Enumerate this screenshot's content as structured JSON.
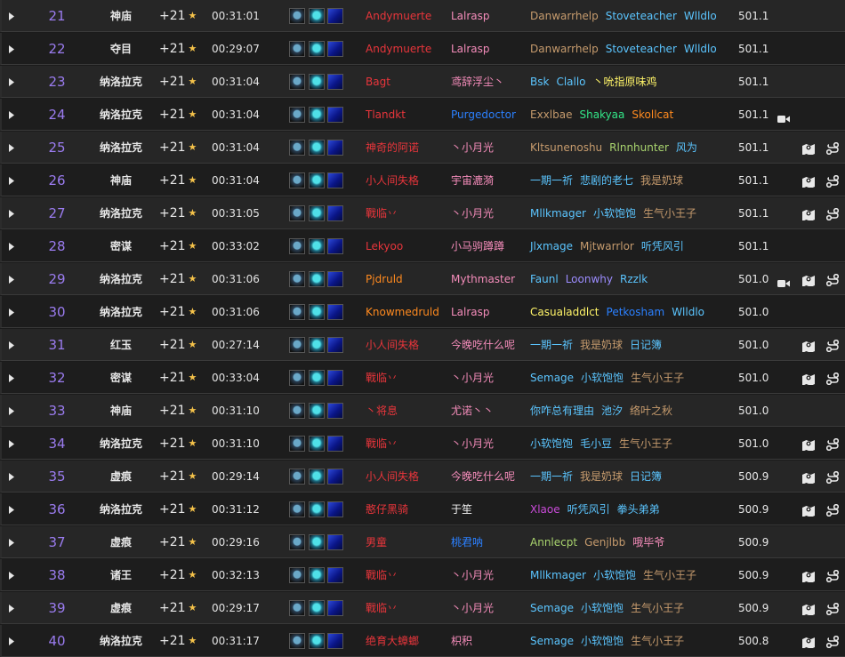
{
  "colors": {
    "rank": "#9b7cf0",
    "star": "#f6c34a",
    "class": {
      "dk": "#e8353b",
      "dh": "#c94bd8",
      "druid": "#ff8a1f",
      "hunter": "#a9d46e",
      "mage": "#5bc5ff",
      "monk": "#33e688",
      "paladin": "#f48cba",
      "priest": "#f4f4f4",
      "rogue": "#fff468",
      "shaman": "#2b80ff",
      "warlock": "#9c8cff",
      "warrior": "#c69b6d"
    }
  },
  "rows": [
    {
      "rank": "21",
      "dungeon": "神庙",
      "level": "+21",
      "time": "00:31:01",
      "tank": {
        "name": "Andymuerte",
        "c": "dk"
      },
      "healer": {
        "name": "Lalrasp",
        "c": "paladin"
      },
      "dps": [
        {
          "name": "Danwarrhelp",
          "c": "warrior"
        },
        {
          "name": "Stoveteacher",
          "c": "mage"
        },
        {
          "name": "Wlldlo",
          "c": "mage"
        }
      ],
      "score": "501.1",
      "video": false,
      "icons": false
    },
    {
      "rank": "22",
      "dungeon": "夺目",
      "level": "+21",
      "time": "00:29:07",
      "tank": {
        "name": "Andymuerte",
        "c": "dk"
      },
      "healer": {
        "name": "Lalrasp",
        "c": "paladin"
      },
      "dps": [
        {
          "name": "Danwarrhelp",
          "c": "warrior"
        },
        {
          "name": "Stoveteacher",
          "c": "mage"
        },
        {
          "name": "Wlldlo",
          "c": "mage"
        }
      ],
      "score": "501.1",
      "video": false,
      "icons": false
    },
    {
      "rank": "23",
      "dungeon": "纳洛拉克",
      "level": "+21",
      "time": "00:31:04",
      "tank": {
        "name": "Bagt",
        "c": "dk"
      },
      "healer": {
        "name": "鸢辞浮尘丶",
        "c": "paladin"
      },
      "dps": [
        {
          "name": "Bsk",
          "c": "mage"
        },
        {
          "name": "Clallo",
          "c": "mage"
        },
        {
          "name": "丶吮指原味鸡",
          "c": "rogue"
        }
      ],
      "score": "501.1",
      "video": false,
      "icons": false
    },
    {
      "rank": "24",
      "dungeon": "纳洛拉克",
      "level": "+21",
      "time": "00:31:04",
      "tank": {
        "name": "Tlandkt",
        "c": "dk"
      },
      "healer": {
        "name": "Purgedoctor",
        "c": "shaman"
      },
      "dps": [
        {
          "name": "Exxlbae",
          "c": "warrior"
        },
        {
          "name": "Shakyaa",
          "c": "monk"
        },
        {
          "name": "Skollcat",
          "c": "druid"
        }
      ],
      "score": "501.1",
      "video": true,
      "icons": false
    },
    {
      "rank": "25",
      "dungeon": "纳洛拉克",
      "level": "+21",
      "time": "00:31:04",
      "tank": {
        "name": "神奇的阿诺",
        "c": "dk"
      },
      "healer": {
        "name": "丶小月光",
        "c": "paladin"
      },
      "dps": [
        {
          "name": "Kltsunenoshu",
          "c": "warrior"
        },
        {
          "name": "Rlnnhunter",
          "c": "hunter"
        },
        {
          "name": "风为",
          "c": "mage"
        }
      ],
      "score": "501.1",
      "video": false,
      "icons": true
    },
    {
      "rank": "26",
      "dungeon": "神庙",
      "level": "+21",
      "time": "00:31:04",
      "tank": {
        "name": "小人间失格",
        "c": "dk"
      },
      "healer": {
        "name": "宇宙漉漪",
        "c": "paladin"
      },
      "dps": [
        {
          "name": "一期一祈",
          "c": "mage"
        },
        {
          "name": "悲剧的老七",
          "c": "mage"
        },
        {
          "name": "我是奶球",
          "c": "warrior"
        }
      ],
      "score": "501.1",
      "video": false,
      "icons": true
    },
    {
      "rank": "27",
      "dungeon": "纳洛拉克",
      "level": "+21",
      "time": "00:31:05",
      "tank": {
        "name": "戰临丷",
        "c": "dk"
      },
      "healer": {
        "name": "丶小月光",
        "c": "paladin"
      },
      "dps": [
        {
          "name": "Mllkmager",
          "c": "mage"
        },
        {
          "name": "小软饱饱",
          "c": "mage"
        },
        {
          "name": "生气小王子",
          "c": "warrior"
        }
      ],
      "score": "501.1",
      "video": false,
      "icons": true
    },
    {
      "rank": "28",
      "dungeon": "密谋",
      "level": "+21",
      "time": "00:33:02",
      "tank": {
        "name": "Lekyoo",
        "c": "dk"
      },
      "healer": {
        "name": "小马驹蹲蹲",
        "c": "paladin"
      },
      "dps": [
        {
          "name": "Jlxmage",
          "c": "mage"
        },
        {
          "name": "Mjtwarrlor",
          "c": "warrior"
        },
        {
          "name": "听凭风引",
          "c": "mage"
        }
      ],
      "score": "501.1",
      "video": false,
      "icons": false
    },
    {
      "rank": "29",
      "dungeon": "纳洛拉克",
      "level": "+21",
      "time": "00:31:06",
      "tank": {
        "name": "Pjdruld",
        "c": "druid"
      },
      "healer": {
        "name": "Mythmaster",
        "c": "paladin"
      },
      "dps": [
        {
          "name": "Faunl",
          "c": "mage"
        },
        {
          "name": "Loonwhy",
          "c": "warlock"
        },
        {
          "name": "Rzzlk",
          "c": "mage"
        }
      ],
      "score": "501.0",
      "video": true,
      "icons": true
    },
    {
      "rank": "30",
      "dungeon": "纳洛拉克",
      "level": "+21",
      "time": "00:31:06",
      "tank": {
        "name": "Knowmedruld",
        "c": "druid"
      },
      "healer": {
        "name": "Lalrasp",
        "c": "paladin"
      },
      "dps": [
        {
          "name": "Casualaddlct",
          "c": "rogue"
        },
        {
          "name": "Petkosham",
          "c": "shaman"
        },
        {
          "name": "Wlldlo",
          "c": "mage"
        }
      ],
      "score": "501.0",
      "video": false,
      "icons": false
    },
    {
      "rank": "31",
      "dungeon": "红玉",
      "level": "+21",
      "time": "00:27:14",
      "tank": {
        "name": "小人间失格",
        "c": "dk"
      },
      "healer": {
        "name": "今晚吃什么呢",
        "c": "paladin"
      },
      "dps": [
        {
          "name": "一期一祈",
          "c": "mage"
        },
        {
          "name": "我是奶球",
          "c": "warrior"
        },
        {
          "name": "日记簿",
          "c": "mage"
        }
      ],
      "score": "501.0",
      "video": false,
      "icons": true
    },
    {
      "rank": "32",
      "dungeon": "密谋",
      "level": "+21",
      "time": "00:33:04",
      "tank": {
        "name": "戰临丷",
        "c": "dk"
      },
      "healer": {
        "name": "丶小月光",
        "c": "paladin"
      },
      "dps": [
        {
          "name": "Semage",
          "c": "mage"
        },
        {
          "name": "小软饱饱",
          "c": "mage"
        },
        {
          "name": "生气小王子",
          "c": "warrior"
        }
      ],
      "score": "501.0",
      "video": false,
      "icons": true
    },
    {
      "rank": "33",
      "dungeon": "神庙",
      "level": "+21",
      "time": "00:31:10",
      "tank": {
        "name": "丶将息",
        "c": "dk"
      },
      "healer": {
        "name": "尤诺丶丶",
        "c": "paladin"
      },
      "dps": [
        {
          "name": "你咋总有理由",
          "c": "mage"
        },
        {
          "name": "池汐",
          "c": "mage"
        },
        {
          "name": "络叶之秋",
          "c": "warrior"
        }
      ],
      "score": "501.0",
      "video": false,
      "icons": false
    },
    {
      "rank": "34",
      "dungeon": "纳洛拉克",
      "level": "+21",
      "time": "00:31:10",
      "tank": {
        "name": "戰临丷",
        "c": "dk"
      },
      "healer": {
        "name": "丶小月光",
        "c": "paladin"
      },
      "dps": [
        {
          "name": "小软饱饱",
          "c": "mage"
        },
        {
          "name": "毛小豆",
          "c": "mage"
        },
        {
          "name": "生气小王子",
          "c": "warrior"
        }
      ],
      "score": "501.0",
      "video": false,
      "icons": true
    },
    {
      "rank": "35",
      "dungeon": "虚痕",
      "level": "+21",
      "time": "00:29:14",
      "tank": {
        "name": "小人间失格",
        "c": "dk"
      },
      "healer": {
        "name": "今晚吃什么呢",
        "c": "paladin"
      },
      "dps": [
        {
          "name": "一期一祈",
          "c": "mage"
        },
        {
          "name": "我是奶球",
          "c": "warrior"
        },
        {
          "name": "日记簿",
          "c": "mage"
        }
      ],
      "score": "500.9",
      "video": false,
      "icons": true
    },
    {
      "rank": "36",
      "dungeon": "纳洛拉克",
      "level": "+21",
      "time": "00:31:12",
      "tank": {
        "name": "憨仔黑骑",
        "c": "dk"
      },
      "healer": {
        "name": "于笙",
        "c": "priest"
      },
      "dps": [
        {
          "name": "Xlaoe",
          "c": "dh"
        },
        {
          "name": "听凭风引",
          "c": "mage"
        },
        {
          "name": "拳头弟弟",
          "c": "mage"
        }
      ],
      "score": "500.9",
      "video": false,
      "icons": true
    },
    {
      "rank": "37",
      "dungeon": "虚痕",
      "level": "+21",
      "time": "00:29:16",
      "tank": {
        "name": "男童",
        "c": "dk"
      },
      "healer": {
        "name": "桃君呐",
        "c": "shaman"
      },
      "dps": [
        {
          "name": "Annlecpt",
          "c": "hunter"
        },
        {
          "name": "Genjlbb",
          "c": "warrior"
        },
        {
          "name": "哦毕爷",
          "c": "paladin"
        }
      ],
      "score": "500.9",
      "video": false,
      "icons": false
    },
    {
      "rank": "38",
      "dungeon": "诸王",
      "level": "+21",
      "time": "00:32:13",
      "tank": {
        "name": "戰临丷",
        "c": "dk"
      },
      "healer": {
        "name": "丶小月光",
        "c": "paladin"
      },
      "dps": [
        {
          "name": "Mllkmager",
          "c": "mage"
        },
        {
          "name": "小软饱饱",
          "c": "mage"
        },
        {
          "name": "生气小王子",
          "c": "warrior"
        }
      ],
      "score": "500.9",
      "video": false,
      "icons": true
    },
    {
      "rank": "39",
      "dungeon": "虚痕",
      "level": "+21",
      "time": "00:29:17",
      "tank": {
        "name": "戰临丷",
        "c": "dk"
      },
      "healer": {
        "name": "丶小月光",
        "c": "paladin"
      },
      "dps": [
        {
          "name": "Semage",
          "c": "mage"
        },
        {
          "name": "小软饱饱",
          "c": "mage"
        },
        {
          "name": "生气小王子",
          "c": "warrior"
        }
      ],
      "score": "500.9",
      "video": false,
      "icons": true
    },
    {
      "rank": "40",
      "dungeon": "纳洛拉克",
      "level": "+21",
      "time": "00:31:17",
      "tank": {
        "name": "绝育大蟑螂",
        "c": "dk"
      },
      "healer": {
        "name": "枳积",
        "c": "paladin"
      },
      "dps": [
        {
          "name": "Semage",
          "c": "mage"
        },
        {
          "name": "小软饱饱",
          "c": "mage"
        },
        {
          "name": "生气小王子",
          "c": "warrior"
        }
      ],
      "score": "500.8",
      "video": false,
      "icons": true
    }
  ]
}
